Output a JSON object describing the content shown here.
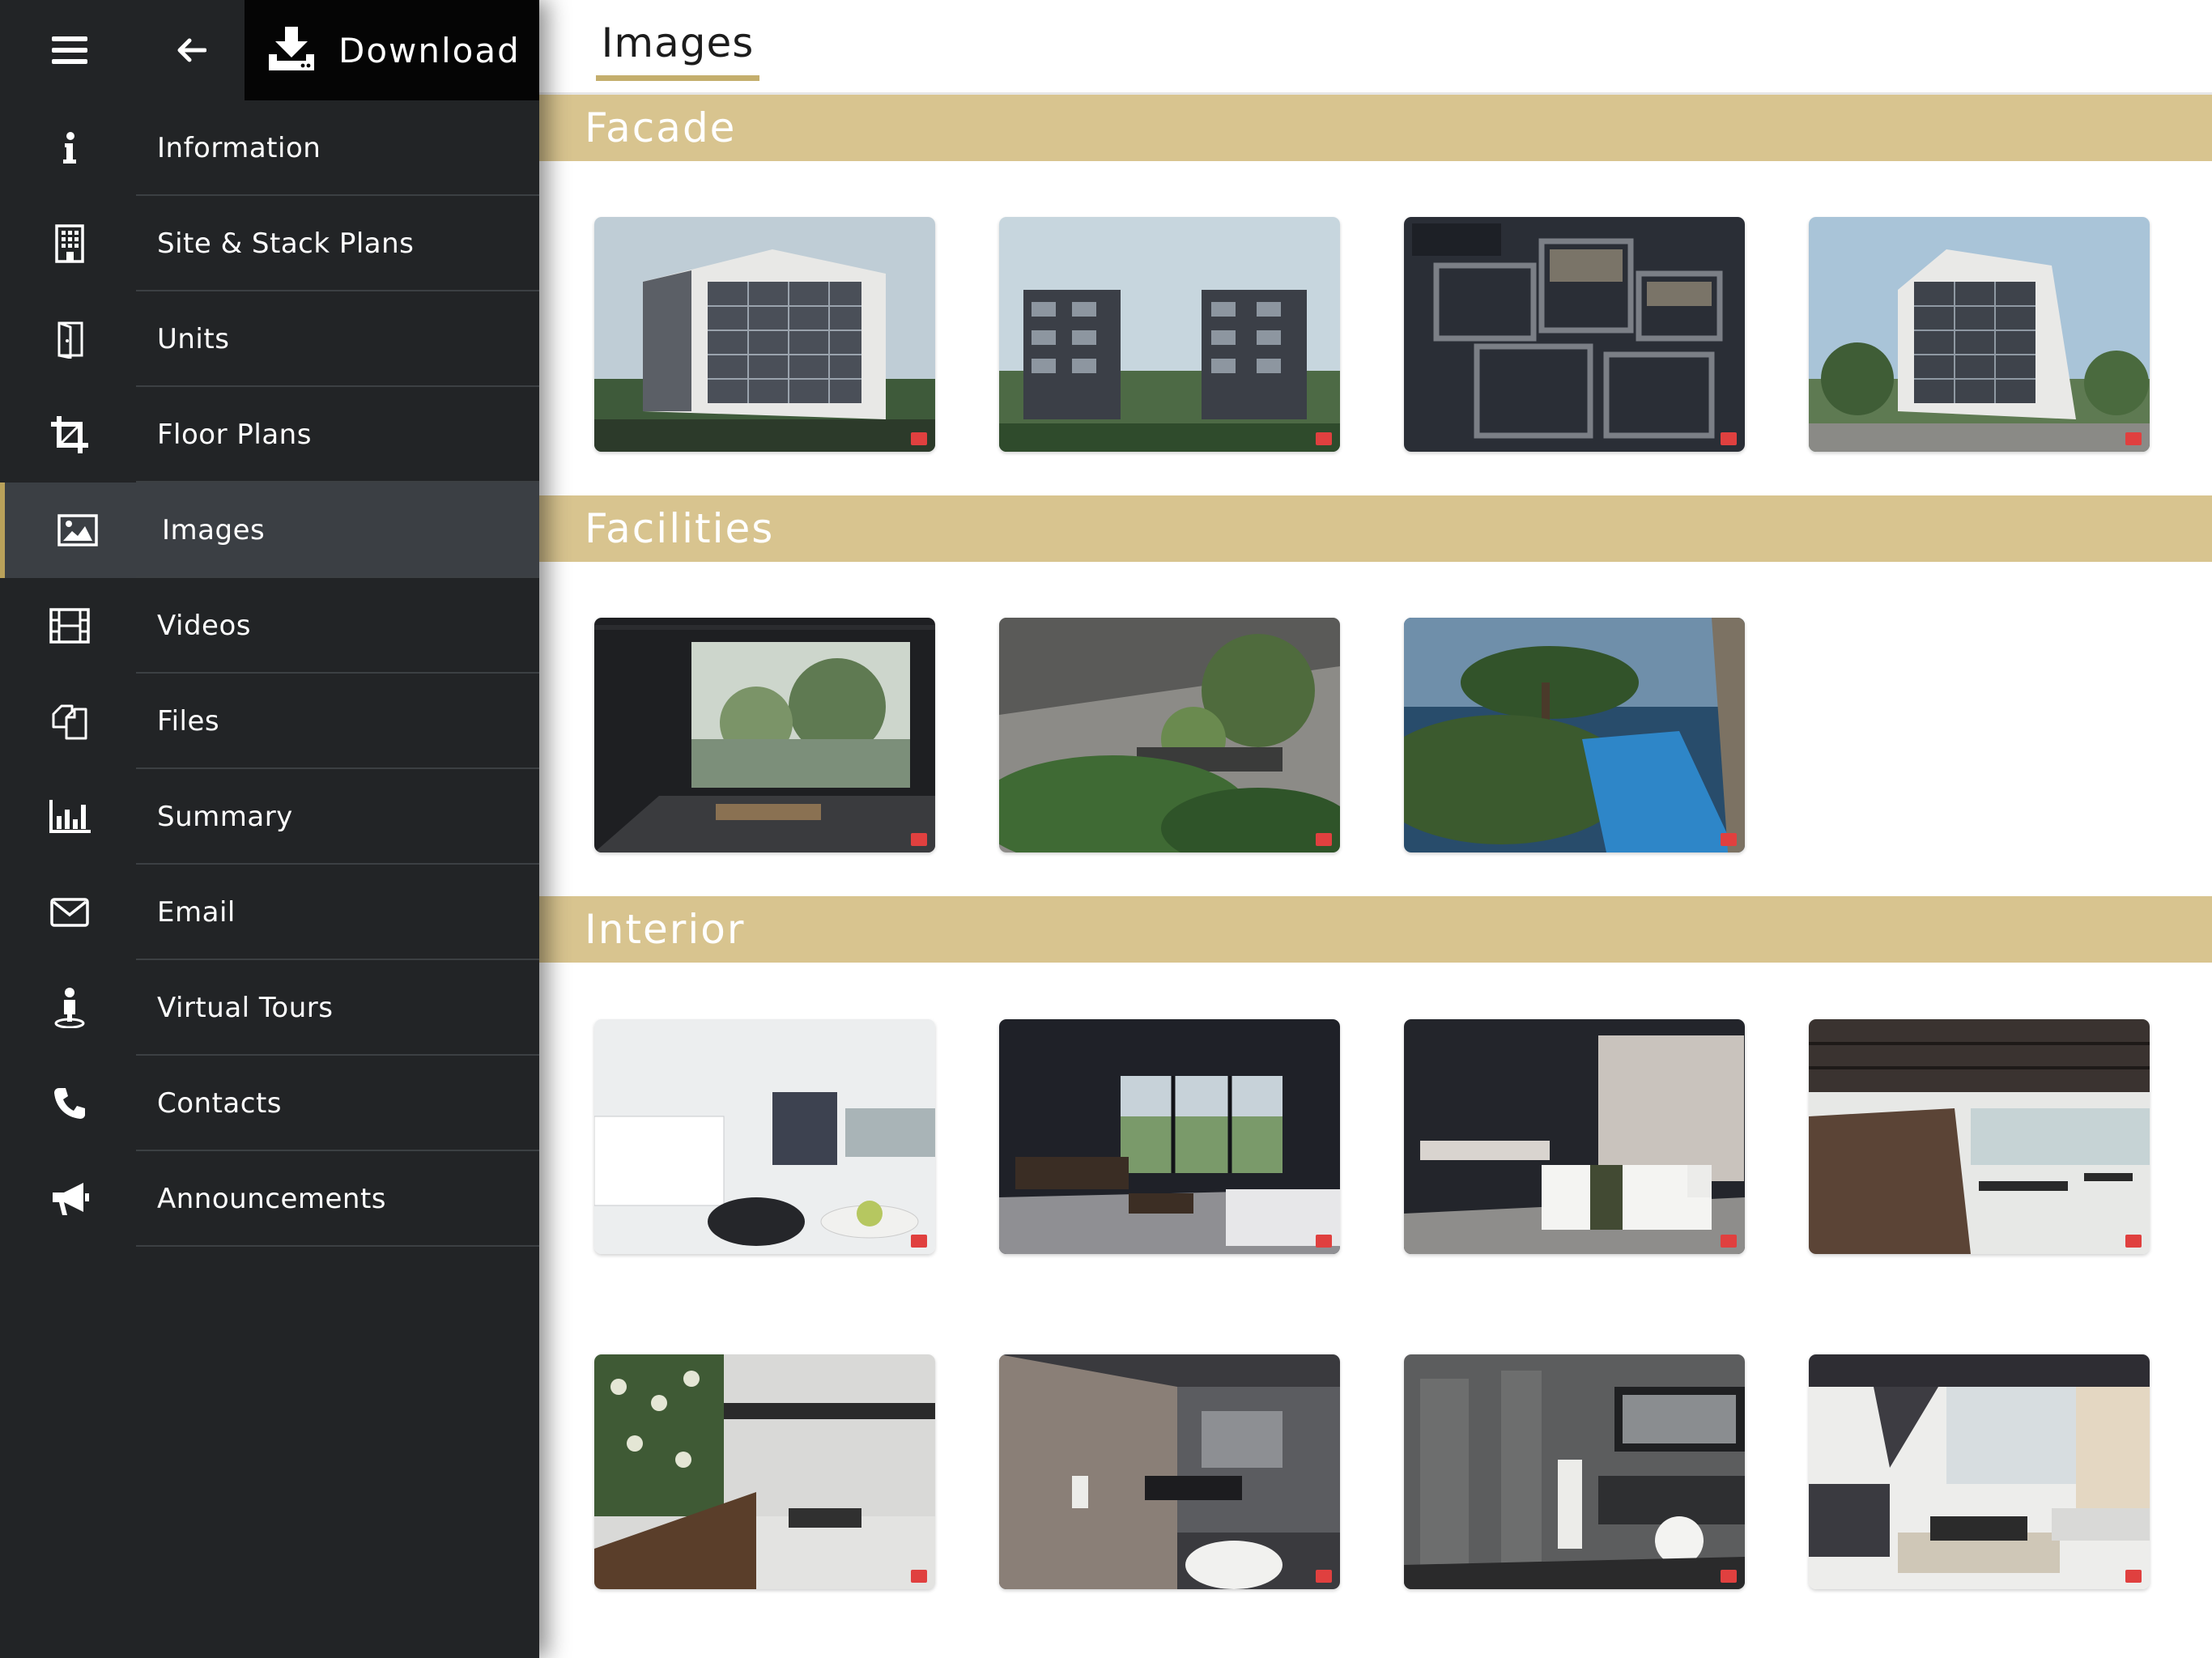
{
  "toolbar": {
    "download_label": "Download",
    "hamburger_icon": "hamburger-menu-icon",
    "back_icon": "arrow-left-icon",
    "download_icon": "download-icon"
  },
  "sidebar": {
    "items": [
      {
        "label": "Information",
        "icon": "info-icon"
      },
      {
        "label": "Site & Stack Plans",
        "icon": "building-icon"
      },
      {
        "label": "Units",
        "icon": "door-icon"
      },
      {
        "label": "Floor Plans",
        "icon": "crop-icon"
      },
      {
        "label": "Images",
        "icon": "image-icon",
        "active": true
      },
      {
        "label": "Videos",
        "icon": "film-icon"
      },
      {
        "label": "Files",
        "icon": "files-icon"
      },
      {
        "label": "Summary",
        "icon": "bar-chart-icon"
      },
      {
        "label": "Email",
        "icon": "envelope-icon"
      },
      {
        "label": "Virtual Tours",
        "icon": "person-pin-icon"
      },
      {
        "label": "Contacts",
        "icon": "phone-icon"
      },
      {
        "label": "Announcements",
        "icon": "megaphone-icon"
      }
    ]
  },
  "main": {
    "tab_label": "Images",
    "sections": [
      {
        "title": "Facade",
        "image_count": 4
      },
      {
        "title": "Facilities",
        "image_count": 3
      },
      {
        "title": "Interior",
        "image_count": 8
      }
    ]
  },
  "colors": {
    "sidebar_bg": "#222426",
    "sidebar_active": "#3b3f44",
    "accent_gold": "#d8c48f",
    "download_bg": "#050505"
  }
}
